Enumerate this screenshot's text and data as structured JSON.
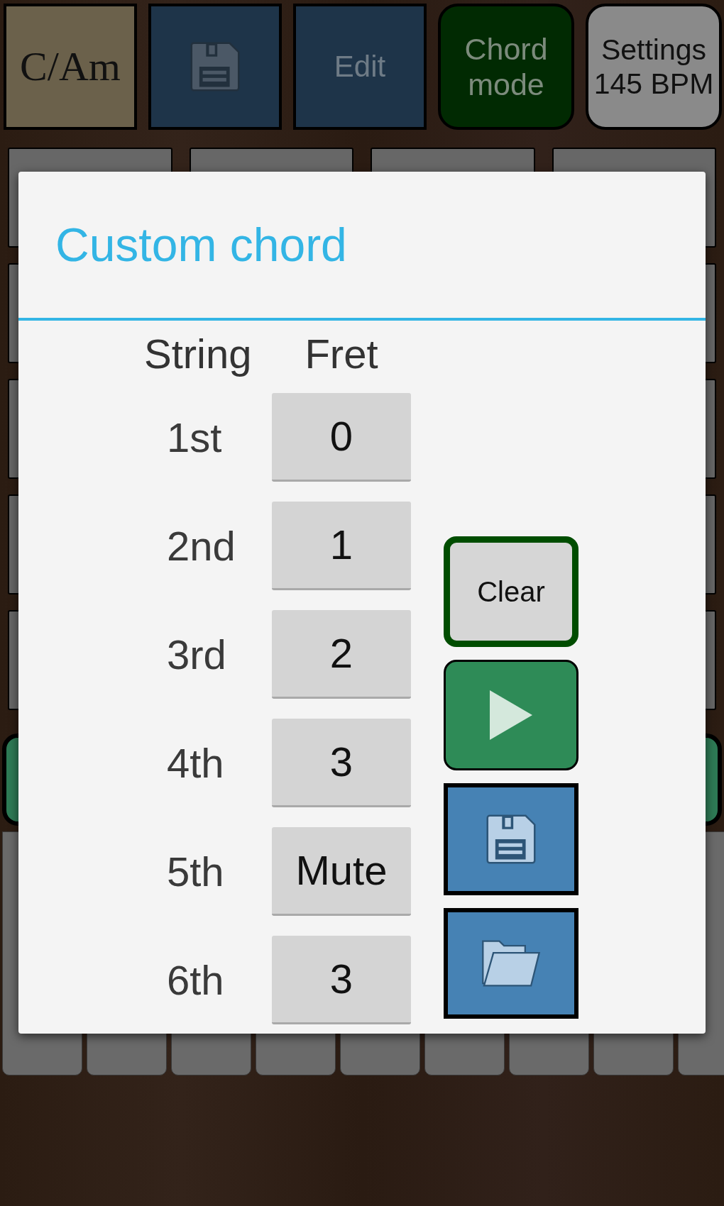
{
  "top_bar": {
    "buttons": [
      {
        "kind": "chord",
        "label": "C/Am",
        "disabled": false
      },
      {
        "kind": "save",
        "disabled": true
      },
      {
        "kind": "edit",
        "label": "Edit",
        "disabled": true
      },
      {
        "kind": "mode",
        "lines": [
          "Chord",
          "mode"
        ],
        "disabled": true
      },
      {
        "kind": "settings",
        "lines": [
          "Settings",
          "145 BPM"
        ],
        "disabled": false
      }
    ]
  },
  "dialog": {
    "title": "Custom chord",
    "columns": [
      "String",
      "Fret"
    ],
    "rows": [
      {
        "string": "1st",
        "fret": "0"
      },
      {
        "string": "2nd",
        "fret": "1"
      },
      {
        "string": "3rd",
        "fret": "2"
      },
      {
        "string": "4th",
        "fret": "3"
      },
      {
        "string": "5th",
        "fret": "Mute"
      },
      {
        "string": "6th",
        "fret": "3"
      }
    ],
    "actions": [
      {
        "kind": "clear",
        "label": "Clear"
      },
      {
        "kind": "play"
      },
      {
        "kind": "save"
      },
      {
        "kind": "open"
      }
    ]
  }
}
